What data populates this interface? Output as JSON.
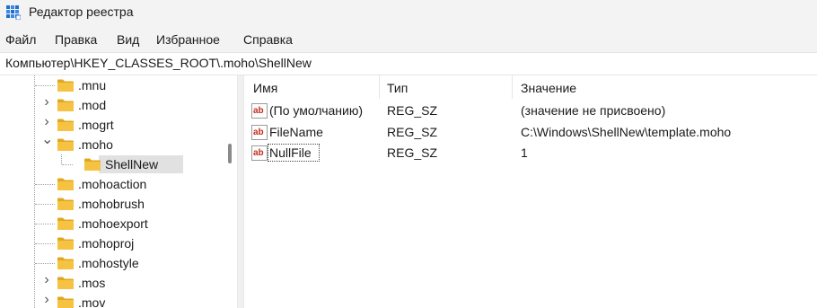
{
  "window": {
    "title": "Редактор реестра"
  },
  "menu": {
    "items": [
      "Файл",
      "Правка",
      "Вид",
      "Избранное",
      "Справка"
    ]
  },
  "address": {
    "path": "Компьютер\\HKEY_CLASSES_ROOT\\.moho\\ShellNew"
  },
  "tree": {
    "items": [
      {
        "label": ".mnu",
        "expander": "none"
      },
      {
        "label": ".mod",
        "expander": "collapsed"
      },
      {
        "label": ".mogrt",
        "expander": "collapsed"
      },
      {
        "label": ".moho",
        "expander": "expanded"
      },
      {
        "label": "ShellNew",
        "expander": "none",
        "selected": true
      },
      {
        "label": ".mohoaction",
        "expander": "none"
      },
      {
        "label": ".mohobrush",
        "expander": "none"
      },
      {
        "label": ".mohoexport",
        "expander": "none"
      },
      {
        "label": ".mohoproj",
        "expander": "none"
      },
      {
        "label": ".mohostyle",
        "expander": "none"
      },
      {
        "label": ".mos",
        "expander": "collapsed"
      },
      {
        "label": ".mov",
        "expander": "collapsed"
      }
    ]
  },
  "list": {
    "columns": {
      "name": "Имя",
      "type": "Тип",
      "value": "Значение"
    },
    "rows": [
      {
        "name": "(По умолчанию)",
        "type": "REG_SZ",
        "value": "(значение не присвоено)",
        "icon": "string-value-icon"
      },
      {
        "name": "FileName",
        "type": "REG_SZ",
        "value": "C:\\Windows\\ShellNew\\template.moho",
        "icon": "string-value-icon"
      },
      {
        "name": "NullFile",
        "type": "REG_SZ",
        "value": "1",
        "icon": "string-value-icon",
        "focused": true
      }
    ]
  },
  "colors": {
    "folder": "#f5c242",
    "folder_dark": "#e0a820",
    "selection": "#e1e1e1",
    "value_icon_red": "#c42b1c",
    "app_icon_blue": "#1f6fd1"
  }
}
